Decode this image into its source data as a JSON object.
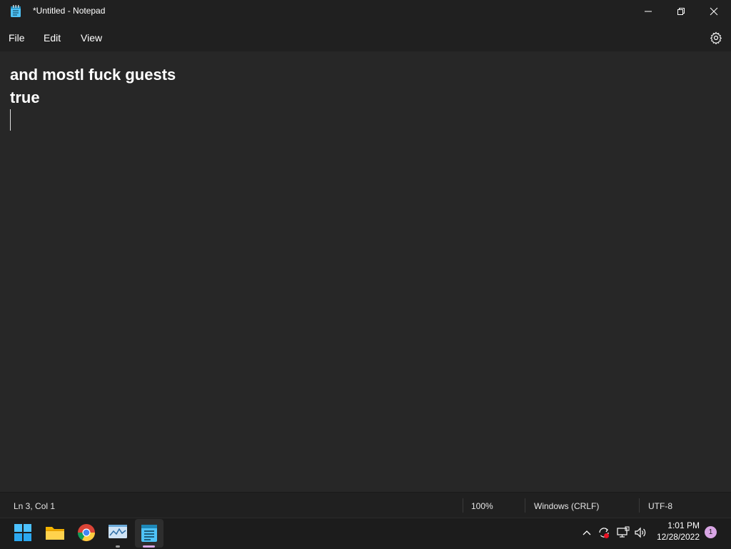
{
  "window": {
    "title": "*Untitled - Notepad"
  },
  "menu": {
    "file": "File",
    "edit": "Edit",
    "view": "View"
  },
  "editor": {
    "lines": [
      "and mostl fuck guests",
      "true",
      ""
    ]
  },
  "status": {
    "position": "Ln 3, Col 1",
    "zoom": "100%",
    "line_ending": "Windows (CRLF)",
    "encoding": "UTF-8"
  },
  "taskbar": {
    "apps": [
      "start-icon",
      "file-explorer-icon",
      "chrome-icon",
      "task-manager-icon",
      "notepad-icon"
    ],
    "clock_time": "1:01 PM",
    "clock_date": "12/28/2022",
    "notification_count": "1"
  },
  "colors": {
    "titlebar_bg": "#202020",
    "editor_bg": "#272727",
    "taskbar_bg": "#1c1c1c",
    "accent": "#d9a6e5"
  }
}
